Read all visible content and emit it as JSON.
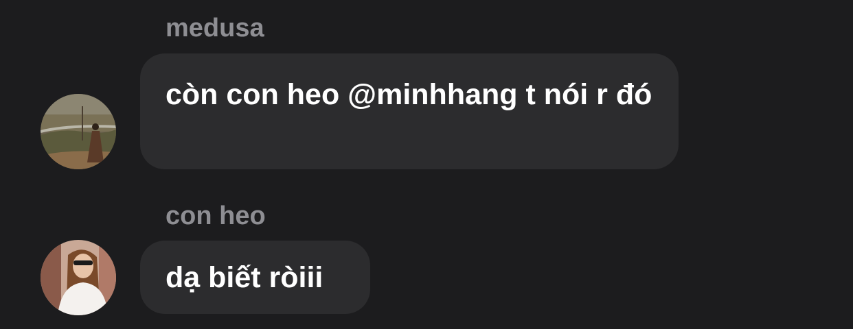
{
  "messages": [
    {
      "sender": "medusa",
      "text": "còn con heo @minhhang t nói r đó",
      "avatar_icon": "user-photo-landscape-icon"
    },
    {
      "sender": "con heo",
      "text": "dạ biết ròiii",
      "avatar_icon": "user-photo-portrait-icon"
    }
  ],
  "colors": {
    "background": "#1c1c1e",
    "bubble": "#2c2c2e",
    "sender_name": "#8e8e93",
    "message_text": "#ffffff"
  }
}
